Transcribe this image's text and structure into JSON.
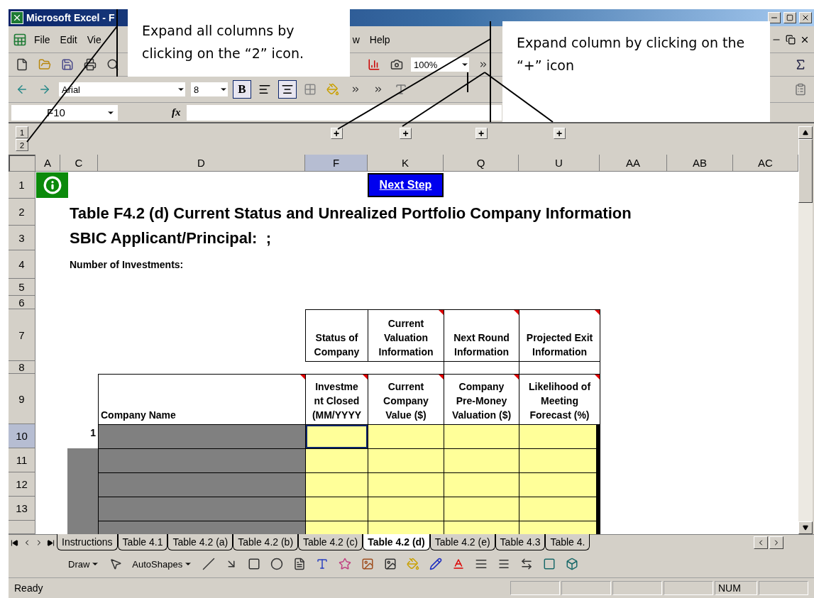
{
  "window": {
    "title": "Microsoft Excel - F"
  },
  "menu": [
    {
      "label": "File"
    },
    {
      "label": "Edit"
    },
    {
      "label": "Vie"
    },
    {
      "label": "w"
    },
    {
      "label": "Help"
    }
  ],
  "standard_toolbar": {
    "zoom": "100%"
  },
  "formatting_toolbar": {
    "font": "Arial",
    "size": "8",
    "bold": {
      "label": "B",
      "selected": true
    },
    "alignment": [
      {
        "kind": "left",
        "selected": false
      },
      {
        "kind": "center",
        "selected": true
      }
    ]
  },
  "formula_bar": {
    "name_box": "F10",
    "function_label": "fx"
  },
  "outline": {
    "levels": [
      "1",
      "2"
    ],
    "expand_buttons": [
      "+",
      "+",
      "+",
      "+"
    ]
  },
  "column_headers": [
    {
      "label": "A",
      "selected": false
    },
    {
      "label": "C",
      "selected": false
    },
    {
      "label": "D",
      "selected": false
    },
    {
      "label": "F",
      "selected": true
    },
    {
      "label": "K",
      "selected": false
    },
    {
      "label": "Q",
      "selected": false
    },
    {
      "label": "U",
      "selected": false
    },
    {
      "label": "AA",
      "selected": false
    },
    {
      "label": "AB",
      "selected": false
    },
    {
      "label": "AC",
      "selected": false
    }
  ],
  "row_headers": [
    {
      "label": "1",
      "selected": false
    },
    {
      "label": "2",
      "selected": false
    },
    {
      "label": "3",
      "selected": false
    },
    {
      "label": "4",
      "selected": false
    },
    {
      "label": "5",
      "selected": false
    },
    {
      "label": "6",
      "selected": false
    },
    {
      "label": "7",
      "selected": false
    },
    {
      "label": "8",
      "selected": false
    },
    {
      "label": "9",
      "selected": false
    },
    {
      "label": "10",
      "selected": true
    },
    {
      "label": "11",
      "selected": false
    },
    {
      "label": "12",
      "selected": false
    },
    {
      "label": "13",
      "selected": false
    }
  ],
  "sheet": {
    "next_step": "Next Step",
    "title": "Table F4.2 (d) Current Status and Unrealized Portfolio Company Information",
    "subtitle": "SBIC Applicant/Principal:  ;",
    "count_label": "Number of Investments:",
    "group_headers": [
      {
        "lines": [
          "Status of",
          "Company"
        ],
        "comment": false
      },
      {
        "lines": [
          "Current",
          "Valuation",
          "Information"
        ],
        "comment": true
      },
      {
        "lines": [
          "Next Round",
          "Information"
        ],
        "comment": true
      },
      {
        "lines": [
          "Projected Exit",
          "Information"
        ],
        "comment": true
      }
    ],
    "column_headers": [
      {
        "lines": [
          "Company Name"
        ],
        "comment": true
      },
      {
        "lines": [
          "Investme",
          "nt Closed",
          "(MM/YYYY"
        ],
        "comment": true
      },
      {
        "lines": [
          "Current",
          "Company",
          "Value ($)"
        ],
        "comment": true
      },
      {
        "lines": [
          "Company",
          "Pre-Money",
          "Valuation ($)"
        ],
        "comment": true
      },
      {
        "lines": [
          "Likelihood of",
          "Meeting",
          "Forecast (%)"
        ],
        "comment": true
      }
    ],
    "rows": [
      {
        "kind": "numbered",
        "label": "1",
        "cells": [
          {
            "selected": true
          },
          {
            "selected": false
          },
          {
            "selected": false
          },
          {
            "selected": false
          }
        ]
      },
      {
        "kind": "blank",
        "cells": [
          {
            "selected": false
          },
          {
            "selected": false
          },
          {
            "selected": false
          },
          {
            "selected": false
          }
        ]
      },
      {
        "kind": "blank",
        "cells": [
          {
            "selected": false
          },
          {
            "selected": false
          },
          {
            "selected": false
          },
          {
            "selected": false
          }
        ]
      },
      {
        "kind": "blank",
        "cells": [
          {
            "selected": false
          },
          {
            "selected": false
          },
          {
            "selected": false
          },
          {
            "selected": false
          }
        ]
      },
      {
        "kind": "blank",
        "cells": [
          {
            "selected": false
          },
          {
            "selected": false
          },
          {
            "selected": false
          },
          {
            "selected": false
          }
        ]
      }
    ]
  },
  "sheet_tabs": [
    {
      "label": "Instructions",
      "selected": false
    },
    {
      "label": "Table 4.1",
      "selected": false
    },
    {
      "label": "Table 4.2 (a)",
      "selected": false
    },
    {
      "label": "Table 4.2 (b)",
      "selected": false
    },
    {
      "label": "Table 4.2 (c)",
      "selected": false
    },
    {
      "label": "Table 4.2 (d)",
      "selected": true
    },
    {
      "label": "Table 4.2 (e)",
      "selected": false
    },
    {
      "label": "Table 4.3",
      "selected": false
    },
    {
      "label": "Table 4.",
      "selected": false
    }
  ],
  "drawing_toolbar": {
    "draw": "Draw",
    "autoshapes": "AutoShapes"
  },
  "status_bar": {
    "status": "Ready",
    "num": "NUM"
  },
  "callouts": [
    {
      "text": "Expand all columns by clicking on the “2” icon."
    },
    {
      "text": "Expand column by clicking on the “+” icon"
    }
  ]
}
